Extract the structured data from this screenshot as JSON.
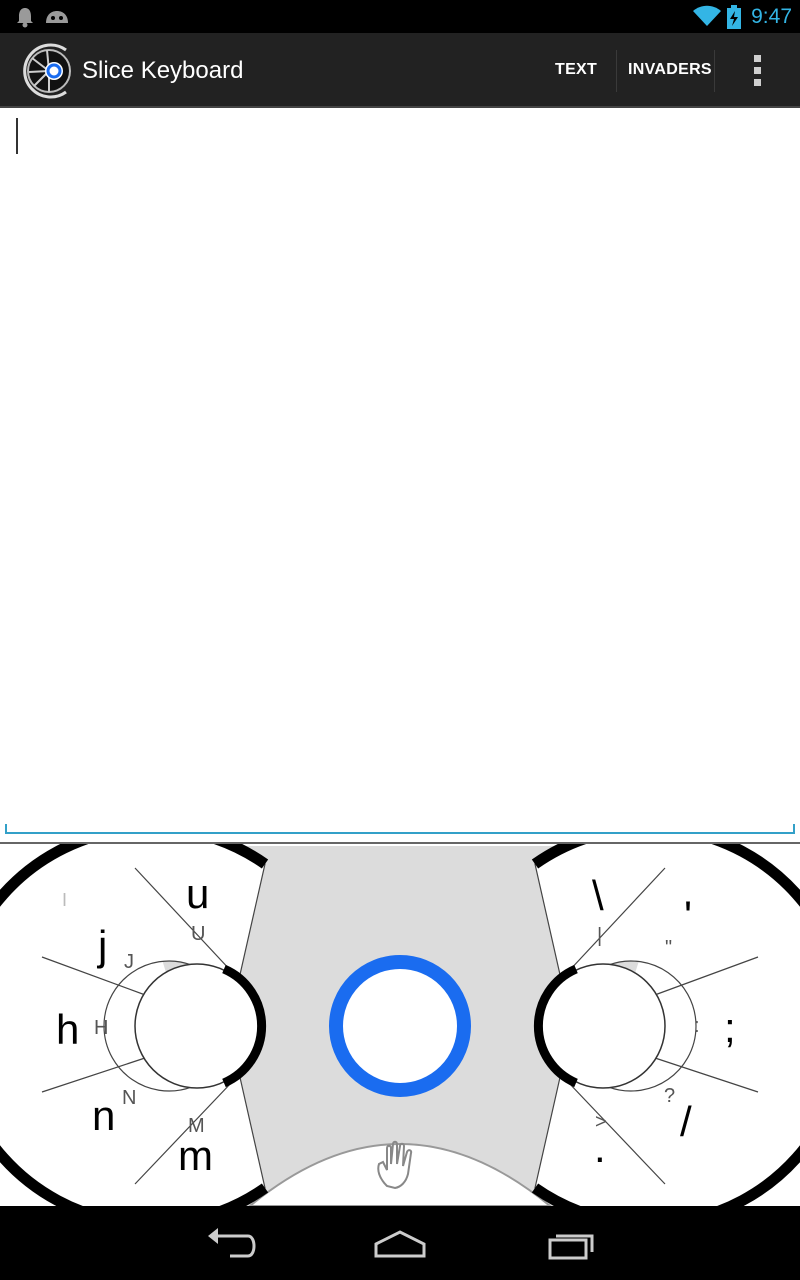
{
  "status_bar": {
    "time": "9:47",
    "left_icons": [
      "notification-bell-icon",
      "android-debug-icon"
    ],
    "right_icons": [
      "wifi-icon",
      "battery-charging-icon"
    ],
    "accent_color": "#33b5e5"
  },
  "action_bar": {
    "title": "Slice Keyboard",
    "actions": [
      {
        "label": "TEXT"
      },
      {
        "label": "INVADERS"
      }
    ],
    "overflow_icon": "overflow-menu-icon",
    "app_icon": "slice-keyboard-logo"
  },
  "editor": {
    "text": ""
  },
  "keyboard": {
    "left_wheel": [
      {
        "main": "u",
        "sub": "U"
      },
      {
        "main": "j",
        "sub": "J"
      },
      {
        "main": "h",
        "sub": "H"
      },
      {
        "main": "n",
        "sub": "N"
      },
      {
        "main": "m",
        "sub": "M"
      }
    ],
    "left_wheel_faint": "I",
    "right_wheel": [
      {
        "main": "\\",
        "sub": "|"
      },
      {
        "main": "'",
        "sub": "\""
      },
      {
        "main": ";",
        "sub": ":"
      },
      {
        "main": "/",
        "sub": "?"
      },
      {
        "main": ".",
        "sub": ">"
      }
    ],
    "center_button_color": "#1a6cf0",
    "hand_icon": "hand-icon"
  },
  "nav_bar": {
    "icons": [
      "back-icon",
      "home-icon",
      "recent-apps-icon"
    ]
  }
}
